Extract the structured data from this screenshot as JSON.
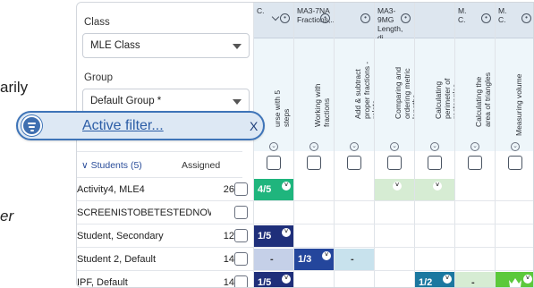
{
  "background": {
    "text1": "arily",
    "text2": "er"
  },
  "class_field": {
    "label": "Class",
    "value": "MLE Class"
  },
  "group_field": {
    "label": "Group",
    "value": "Default Group *"
  },
  "filter_pill": {
    "label": "Active filter...",
    "close": "X"
  },
  "students_header": {
    "label": "Students (5)",
    "assigned": "Assigned"
  },
  "columns": [
    {
      "code": "C.",
      "sub": "",
      "vertical": "urse with 5\nsteps"
    },
    {
      "code": "MA3-7NA",
      "sub": "Fractions,...",
      "vertical": "Working with\nfractions"
    },
    {
      "code": "",
      "sub": "",
      "vertical": "Add & subtract\nproper fractions -\nrelate"
    },
    {
      "code": "MA3-9MG",
      "sub": "Length, di...",
      "vertical": "Comparing and\nordering metric\nlengths"
    },
    {
      "code": "",
      "sub": "",
      "vertical": "Calculating\nperimeter of\nrectangles"
    },
    {
      "code": "M.",
      "sub": "C.",
      "vertical": "Calculating the\narea of triangles"
    },
    {
      "code": "M.",
      "sub": "C.",
      "vertical": "Measuring volume"
    }
  ],
  "students": [
    {
      "name": "Activity4, MLE4",
      "count": "26"
    },
    {
      "name": "SCREENISTOBETESTEDNOWWITH",
      "count": ""
    },
    {
      "name": "Student, Secondary",
      "count": "12"
    },
    {
      "name": "Student 2, Default",
      "count": "14"
    },
    {
      "name": "IPF, Default",
      "count": "14"
    }
  ],
  "cells": {
    "r0c0": "4/5",
    "r2c0": "1/5",
    "r3c0": "-",
    "r3c1": "1/3",
    "r3c2": "-",
    "r4c0": "1/5",
    "r4c4": "1/2",
    "r4c5": "-"
  },
  "colors": {
    "accent": "#3e74b8",
    "green": "#1fb57d",
    "navy": "#1f2f7a",
    "teal": "#1b78a0"
  }
}
